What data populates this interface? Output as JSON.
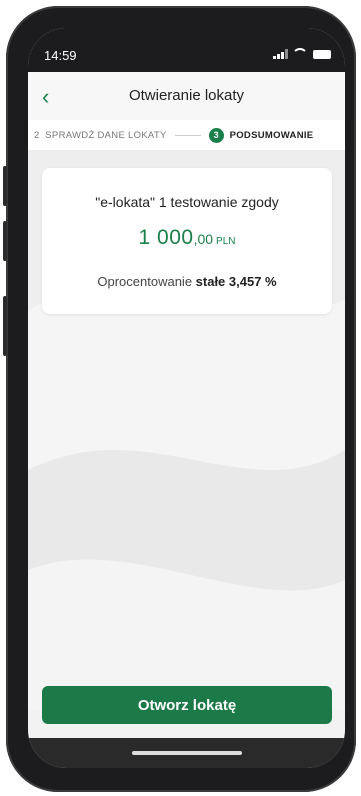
{
  "status_bar": {
    "time": "14:59"
  },
  "header": {
    "title": "Otwieranie lokaty"
  },
  "steps": {
    "prev_number": "2",
    "prev_label": "SPRAWDŹ DANE LOKATY",
    "current_number": "3",
    "current_label": "PODSUMOWANIE"
  },
  "summary": {
    "deposit_name": "\"e-lokata\"  1 testowanie zgody",
    "amount_integer": "1 000",
    "amount_decimal": ",00",
    "currency": "PLN",
    "rate_prefix": "Oprocentowanie ",
    "rate_type": "stałe",
    "rate_value": " 3,457 %"
  },
  "actions": {
    "open_label": "Otworz lokatę"
  },
  "colors": {
    "brand_green": "#1b7a48",
    "accent_green": "#1a7f4b"
  }
}
